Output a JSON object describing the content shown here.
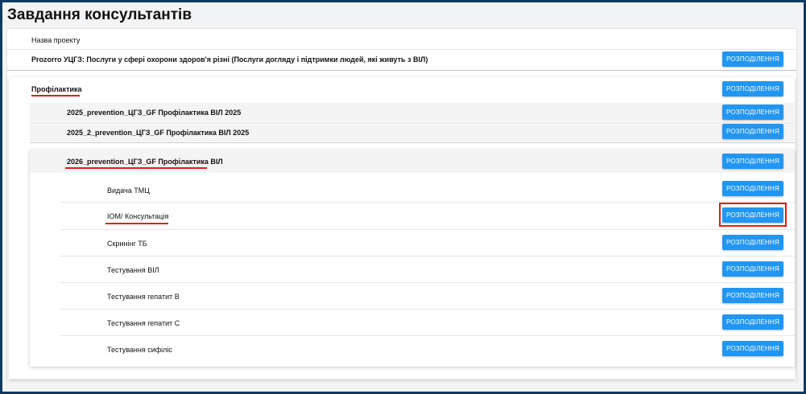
{
  "page": {
    "title": "Завдання консультантів"
  },
  "header": {
    "column_label": "Назва проекту"
  },
  "button_label": "РОЗПОДІЛЕННЯ",
  "project": {
    "name": "Prozorro УЦГЗ: Послуги у сфері охорони здоров'я різні (Послуги догляду і підтримки людей, які живуть з ВІЛ)"
  },
  "category": {
    "name": "Профілактика"
  },
  "subprojects": [
    {
      "name": "2025_prevention_ЦГЗ_GF Профілактика ВІЛ 2025"
    },
    {
      "name": "2025_2_prevention_ЦГЗ_GF Профілактика ВІЛ 2025"
    },
    {
      "name": "2026_prevention_ЦГЗ_GF Профілактика ВІЛ"
    }
  ],
  "tasks": [
    {
      "name": "Видача ТМЦ"
    },
    {
      "name": "ІОМ/ Консультація"
    },
    {
      "name": "Скринінг ТБ"
    },
    {
      "name": "Тестування ВІЛ"
    },
    {
      "name": "Тестування гепатит В"
    },
    {
      "name": "Тестування гепатит С"
    },
    {
      "name": "Тестування сифіліс"
    }
  ],
  "colors": {
    "accent": "#2196f3",
    "highlight": "#e11b1b",
    "frame": "#0f3a63"
  }
}
